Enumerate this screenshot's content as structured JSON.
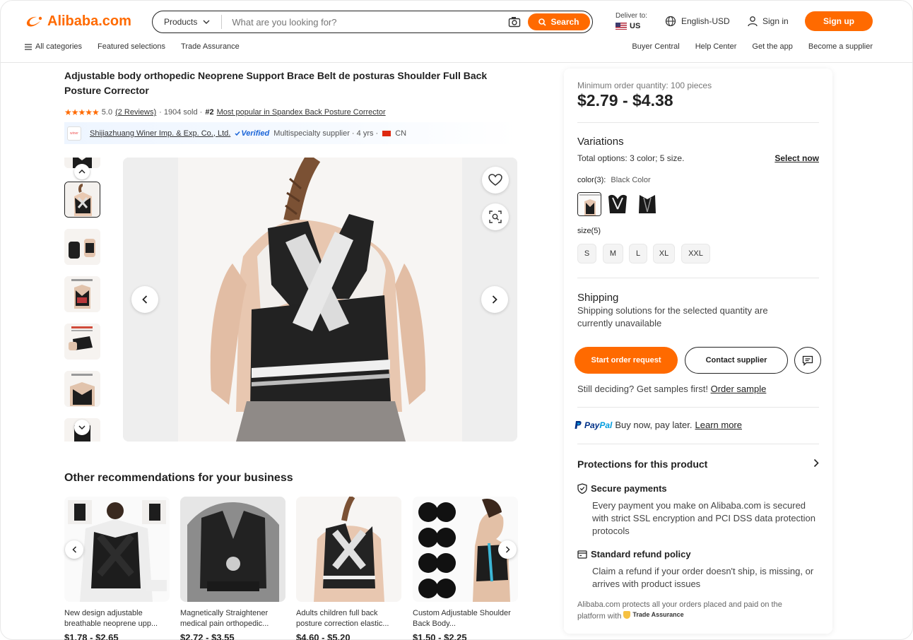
{
  "header": {
    "logo": "Alibaba.com",
    "search_category": "Products",
    "search_placeholder": "What are you looking for?",
    "search_button": "Search",
    "deliver_label": "Deliver to:",
    "deliver_country": "US",
    "language": "English-USD",
    "signin": "Sign in",
    "signup": "Sign up",
    "nav_left": [
      "All categories",
      "Featured selections",
      "Trade Assurance"
    ],
    "nav_right": [
      "Buyer Central",
      "Help Center",
      "Get the app",
      "Become a supplier"
    ]
  },
  "product": {
    "title": "Adjustable body orthopedic Neoprene Support Brace Belt de posturas Shoulder Full Back Posture Corrector",
    "stars": "★★★★★",
    "rating": "5.0",
    "reviews": "(2 Reviews)",
    "sold": "· 1904 sold ·",
    "rank": "#2",
    "rank_text": "Most popular in Spandex Back Posture Corrector",
    "supplier_logo_text": "winer",
    "supplier_name": "Shijiazhuang Winer Imp. & Exp. Co., Ltd.",
    "verified": "Verified",
    "supplier_type": "Multispecialty supplier · 4 yrs ·",
    "supplier_country": "CN"
  },
  "recommendations": {
    "title": "Other recommendations for your business",
    "items": [
      {
        "name": "New design adjustable breathable neoprene upp...",
        "price": "$1.78 - $2.65"
      },
      {
        "name": "Magnetically Straightener medical pain orthopedic...",
        "price": "$2.72 - $3.55"
      },
      {
        "name": "Adults children full back posture correction elastic...",
        "price": "$4.60 - $5.20"
      },
      {
        "name": "Custom Adjustable Shoulder Back Body...",
        "price": "$1.50 - $2.25"
      }
    ]
  },
  "panel": {
    "moq": "Minimum order quantity: 100 pieces",
    "price": "$2.79 - $4.38",
    "variations_title": "Variations",
    "total_options_label": "Total options:",
    "total_options_value": "3 color; 5 size.",
    "select_now": "Select now",
    "color_label": "color(3):",
    "color_value": "Black Color",
    "size_label": "size(5)",
    "sizes": [
      "S",
      "M",
      "L",
      "XL",
      "XXL"
    ],
    "shipping_title": "Shipping",
    "shipping_text": "Shipping solutions for the selected quantity are currently unavailable",
    "start_order": "Start order request",
    "contact_supplier": "Contact supplier",
    "samples_text": "Still deciding? Get samples first!",
    "order_sample": "Order sample",
    "paypal_text": "Buy now, pay later.",
    "learn_more": "Learn more",
    "protections_title": "Protections for this product",
    "secure_title": "Secure payments",
    "secure_text": "Every payment you make on Alibaba.com is secured with strict SSL encryption and PCI DSS data protection protocols",
    "refund_title": "Standard refund policy",
    "refund_text": "Claim a refund if your order doesn't ship, is missing, or arrives with product issues",
    "ta_note": "Alibaba.com protects all your orders placed and paid on the platform with",
    "ta_badge": "Trade Assurance"
  },
  "colors": {
    "accent": "#ff6a00",
    "text": "#222222",
    "verified_blue": "#1a64d8"
  }
}
